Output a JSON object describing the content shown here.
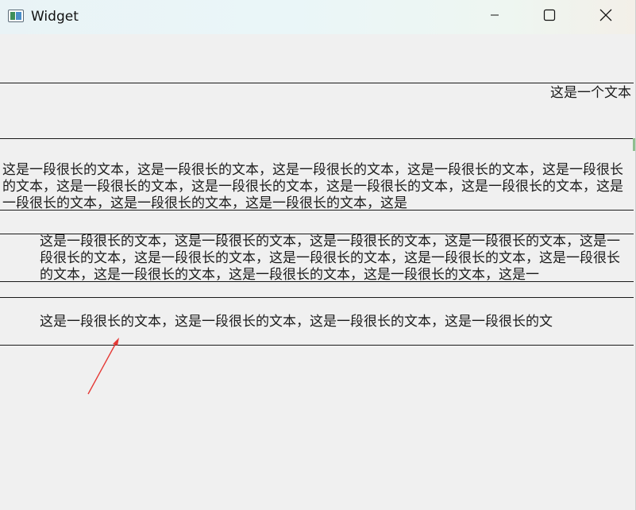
{
  "window": {
    "title": "Widget"
  },
  "labels": {
    "short": "这是一个文本",
    "long_full": "这是一段很长的文本，这是一段很长的文本，这是一段很长的文本，这是一段很长的文本，这是一段很长的文本，这是一段很长的文本，这是一段很长的文本，这是一段很长的文本，这是一段很长的文本，这是一段很长的文本，这是一段很长的文本，这是一段很长的文本，这是",
    "long_indent": "这是一段很长的文本，这是一段很长的文本，这是一段很长的文本，这是一段很长的文本，这是一段很长的文本，这是一段很长的文本，这是一段很长的文本，这是一段很长的文本，这是一段很长的文本，这是一段很长的文本，这是一段很长的文本，这是一段很长的文本，这是一",
    "single_line": "这是一段很长的文本，这是一段很长的文本，这是一段很长的文本，这是一段很长的文"
  },
  "colors": {
    "arrow": "#e53935",
    "line": "#1a1a1a",
    "background": "#f0f0f0"
  },
  "icons": {
    "app": "window-app-icon",
    "minimize": "minimize-icon",
    "maximize": "maximize-icon",
    "close": "close-icon"
  }
}
